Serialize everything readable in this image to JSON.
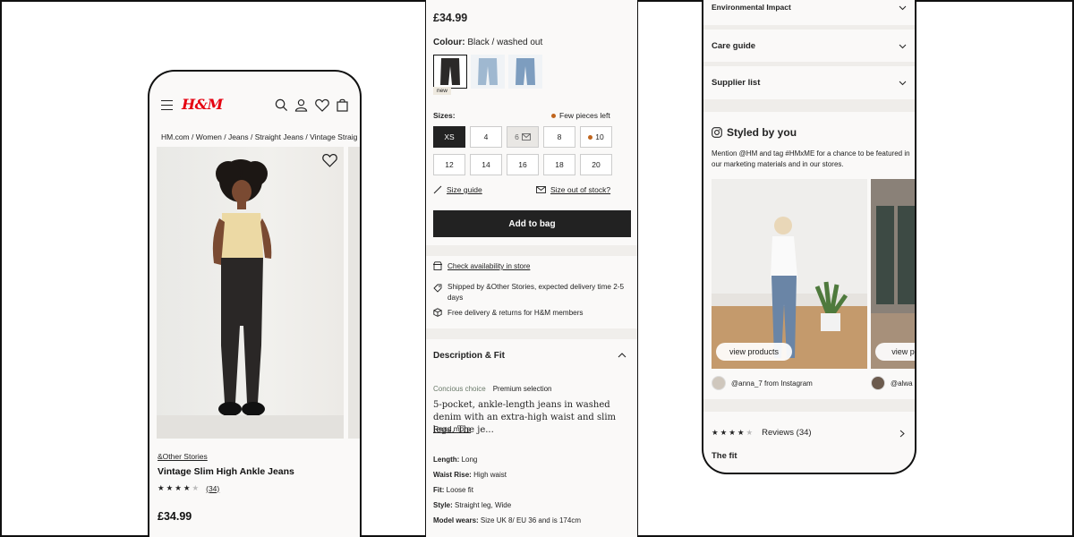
{
  "phone1": {
    "logo": "H&M",
    "breadcrumb": "HM.com / Women / Jeans / Straight Jeans / Vintage Straig",
    "brand": "&Other Stories",
    "product_name": "Vintage Slim High Ankle Jeans",
    "rating": 4,
    "review_count": "(34)",
    "price": "£34.99"
  },
  "product": {
    "price": "£34.99",
    "colour_label": "Colour:",
    "colour_value": "Black / washed out",
    "new_badge": "new",
    "sizes_label": "Sizes:",
    "few_left": "Few pieces left",
    "sizes_row1": [
      "XS",
      "4",
      "6",
      "8",
      "10"
    ],
    "sizes_row2": [
      "12",
      "14",
      "16",
      "18",
      "20"
    ],
    "size_guide": "Size guide",
    "size_out": "Size out of stock?",
    "add_to_bag": "Add to bag",
    "check_store": "Check availability in store",
    "shipped": "Shipped by &Other Stories, expected delivery time 2-5 days",
    "free_delivery": "Free delivery & returns for H&M members",
    "desc_title": "Description & Fit",
    "tag_conscious": "Concious choice",
    "tag_premium": "Premium selection",
    "description": "5-pocket, ankle-length jeans in washed denim with an extra-high waist and slim legs. The je...",
    "read_more": "Read more",
    "specs": [
      {
        "k": "Length:",
        "v": "Long"
      },
      {
        "k": "Waist Rise:",
        "v": "High waist"
      },
      {
        "k": "Fit:",
        "v": "Loose fit"
      },
      {
        "k": "Style:",
        "v": "Straight leg, Wide"
      },
      {
        "k": "Model wears:",
        "v": "Size UK 8/ EU 36 and is 174cm"
      }
    ]
  },
  "phone3": {
    "env_impact": "Environmental Impact",
    "care_guide": "Care guide",
    "supplier_list": "Supplier list",
    "styled_title": "Styled by you",
    "styled_desc": "Mention @HM and tag #HMxME for a chance to be featured in our marketing materials and in our stores.",
    "view_products": "view products",
    "view_products_2": "view pro",
    "user1": "@anna_7 from Instagram",
    "user2": "@alwa",
    "reviews_rating": 4,
    "reviews_label": "Reviews (34)",
    "fit_title": "The fit"
  },
  "colors": {
    "brand_red": "#e50010",
    "dark": "#222222",
    "orange_dot": "#c0651d"
  }
}
